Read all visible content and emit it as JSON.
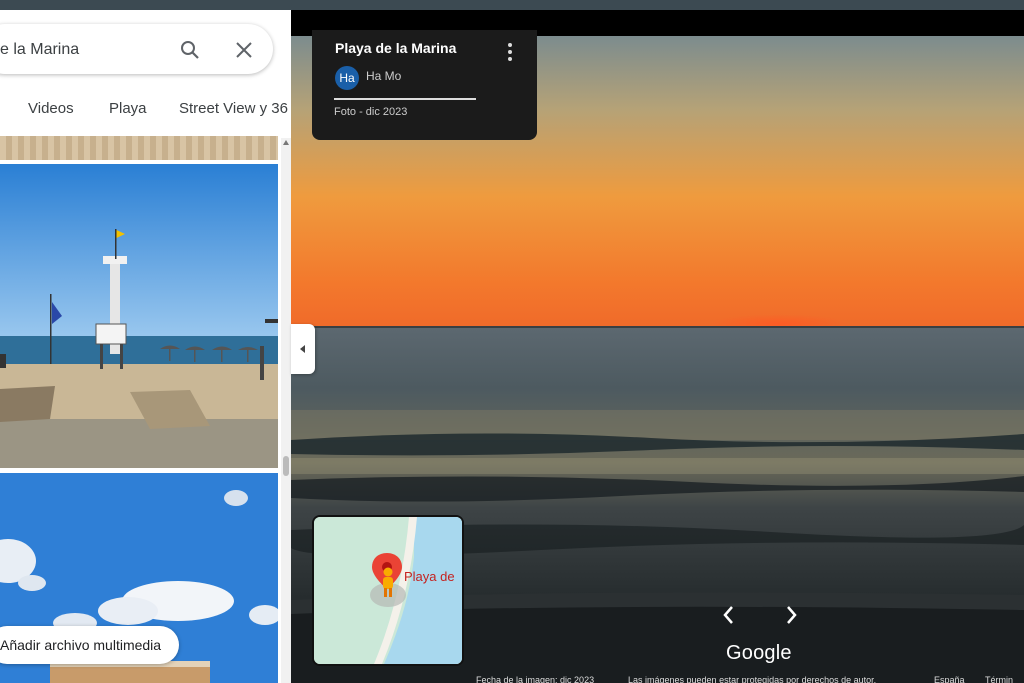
{
  "search": {
    "value": "e la Marina",
    "placeholder": ""
  },
  "chips": {
    "videos": "Videos",
    "playa": "Playa",
    "street_view": "Street View y 36"
  },
  "add_media_label": "Añadir archivo multimedia",
  "info_card": {
    "title": "Playa de la Marina",
    "avatar_initials": "Ha",
    "author": "Ha Mo",
    "photo_date": "Foto - dic 2023"
  },
  "minimap": {
    "label": "Playa de"
  },
  "google_label": "Google",
  "footer": {
    "image_date": "Fecha de la imagen: dic 2023",
    "copyright": "Las imágenes pueden estar protegidas por derechos de autor.",
    "region": "España",
    "terms": "Términ"
  },
  "colors": {
    "avatar": "#1a5fa8",
    "pin": "#ea4335",
    "pegman": "#f9ab00",
    "water": "#a8d8ee",
    "land": "#cbe8d8"
  },
  "icons": {
    "search": "search-icon",
    "close": "close-icon",
    "menu": "more-vert-icon",
    "nav_left": "chevron-left-icon",
    "nav_right": "chevron-right-icon",
    "collapse": "chevron-left-icon",
    "pegman": "pegman-icon",
    "pin": "map-pin-icon"
  }
}
